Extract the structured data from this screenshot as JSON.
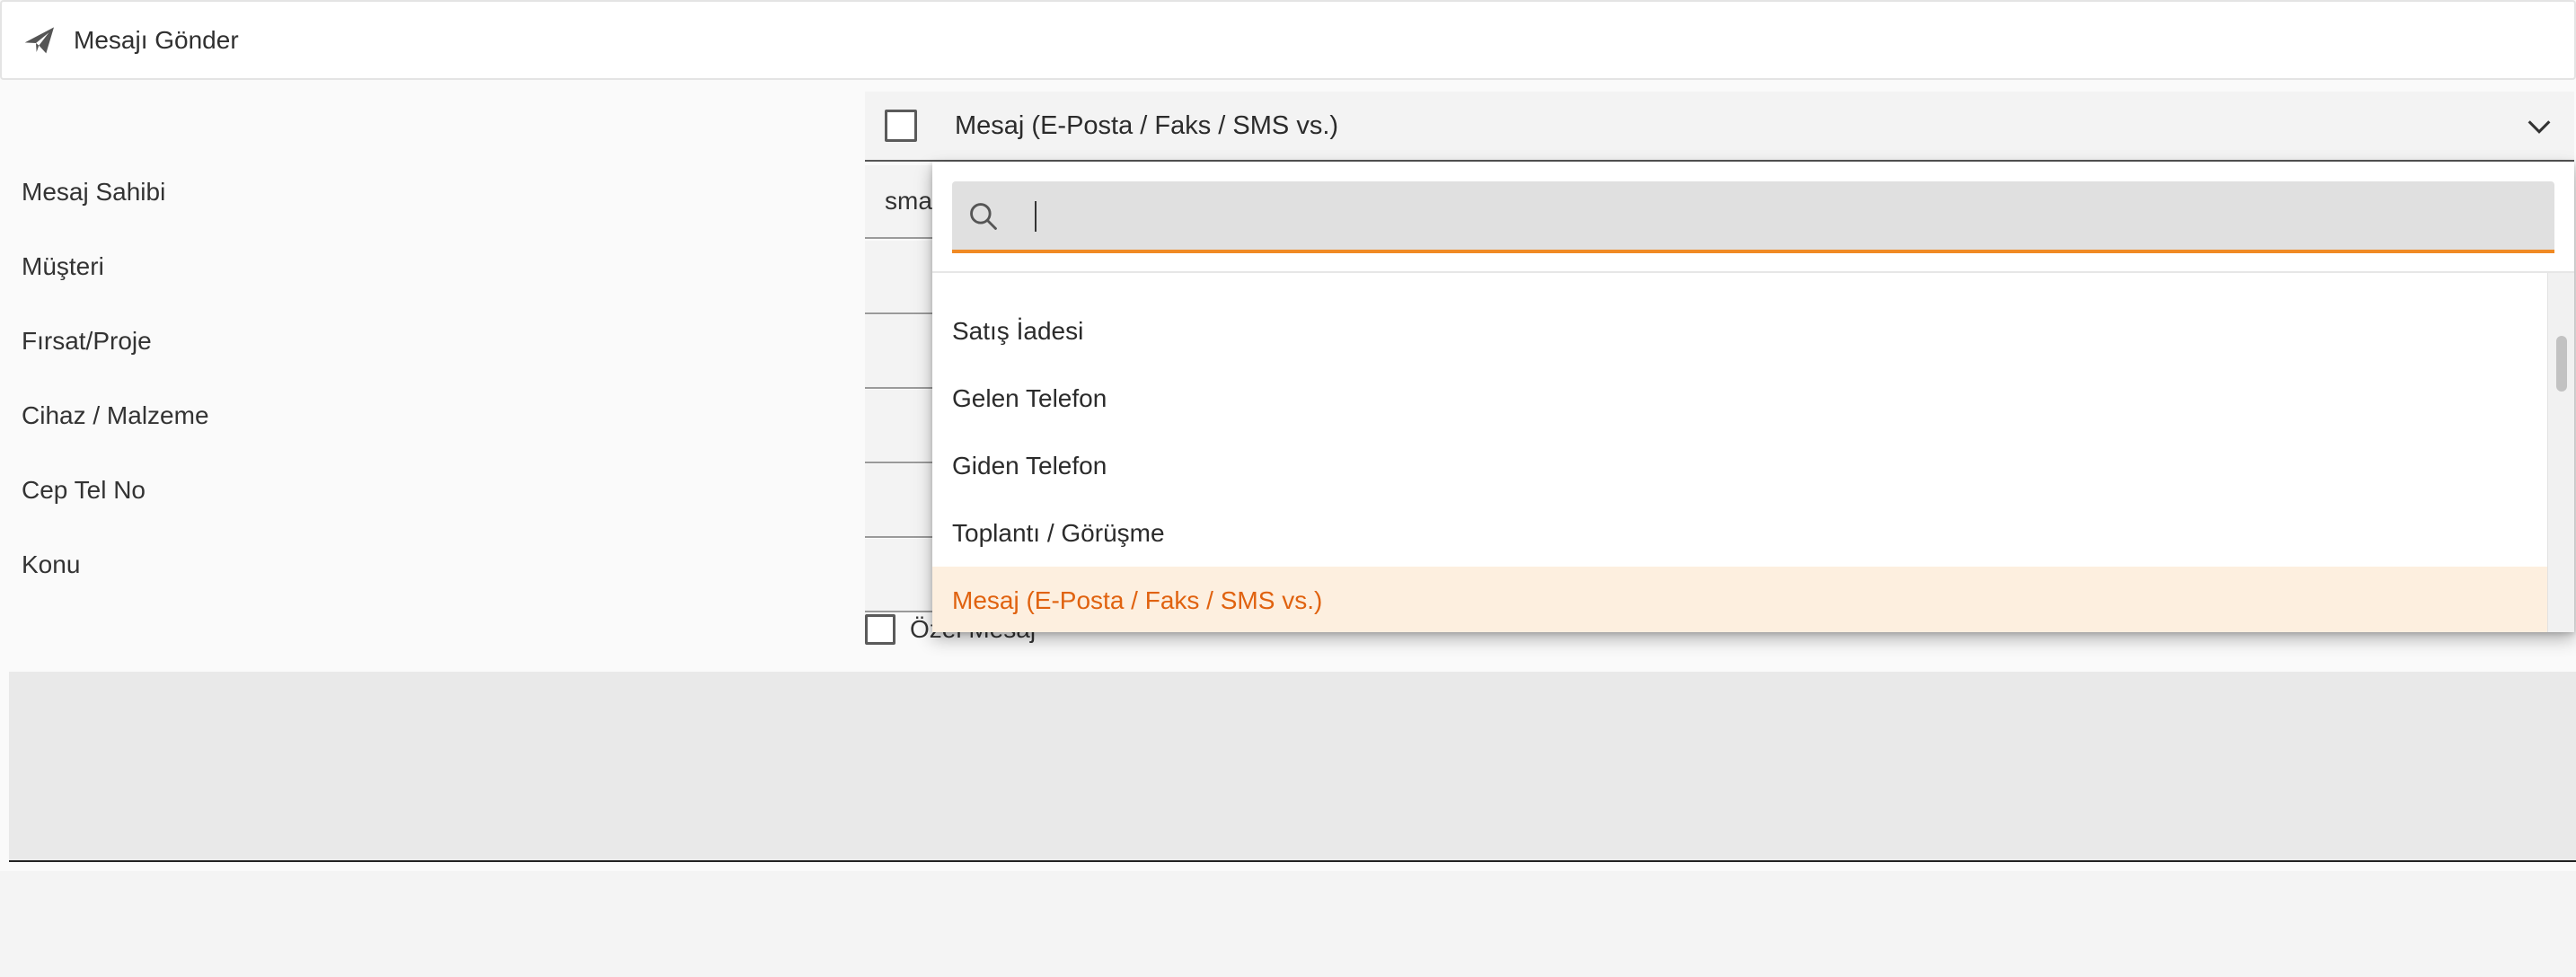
{
  "toolbar": {
    "send_label": "Mesajı Gönder",
    "send_icon": "paper-plane-icon"
  },
  "form": {
    "labels": {
      "owner": "Mesaj Sahibi",
      "customer": "Müşteri",
      "opportunity": "Fırsat/Proje",
      "device": "Cihaz / Malzeme",
      "mobile": "Cep Tel No",
      "subject": "Konu"
    },
    "activity_type": {
      "value": "Mesaj (E-Posta / Faks / SMS vs.)",
      "chevron_icon": "chevron-down-icon"
    },
    "owner_value": "sma",
    "private_message_label": "Özel Mesaj"
  },
  "dropdown": {
    "search_value": "",
    "search_icon": "search-icon",
    "options": [
      {
        "label": "Satış İadesi",
        "selected": false
      },
      {
        "label": "Gelen Telefon",
        "selected": false
      },
      {
        "label": "Giden Telefon",
        "selected": false
      },
      {
        "label": "Toplantı / Görüşme",
        "selected": false
      },
      {
        "label": "Mesaj (E-Posta / Faks / SMS vs.)",
        "selected": true
      }
    ]
  },
  "colors": {
    "accent": "#f08a24",
    "selected_text": "#e0620f",
    "selected_bg": "#fdefdf"
  }
}
